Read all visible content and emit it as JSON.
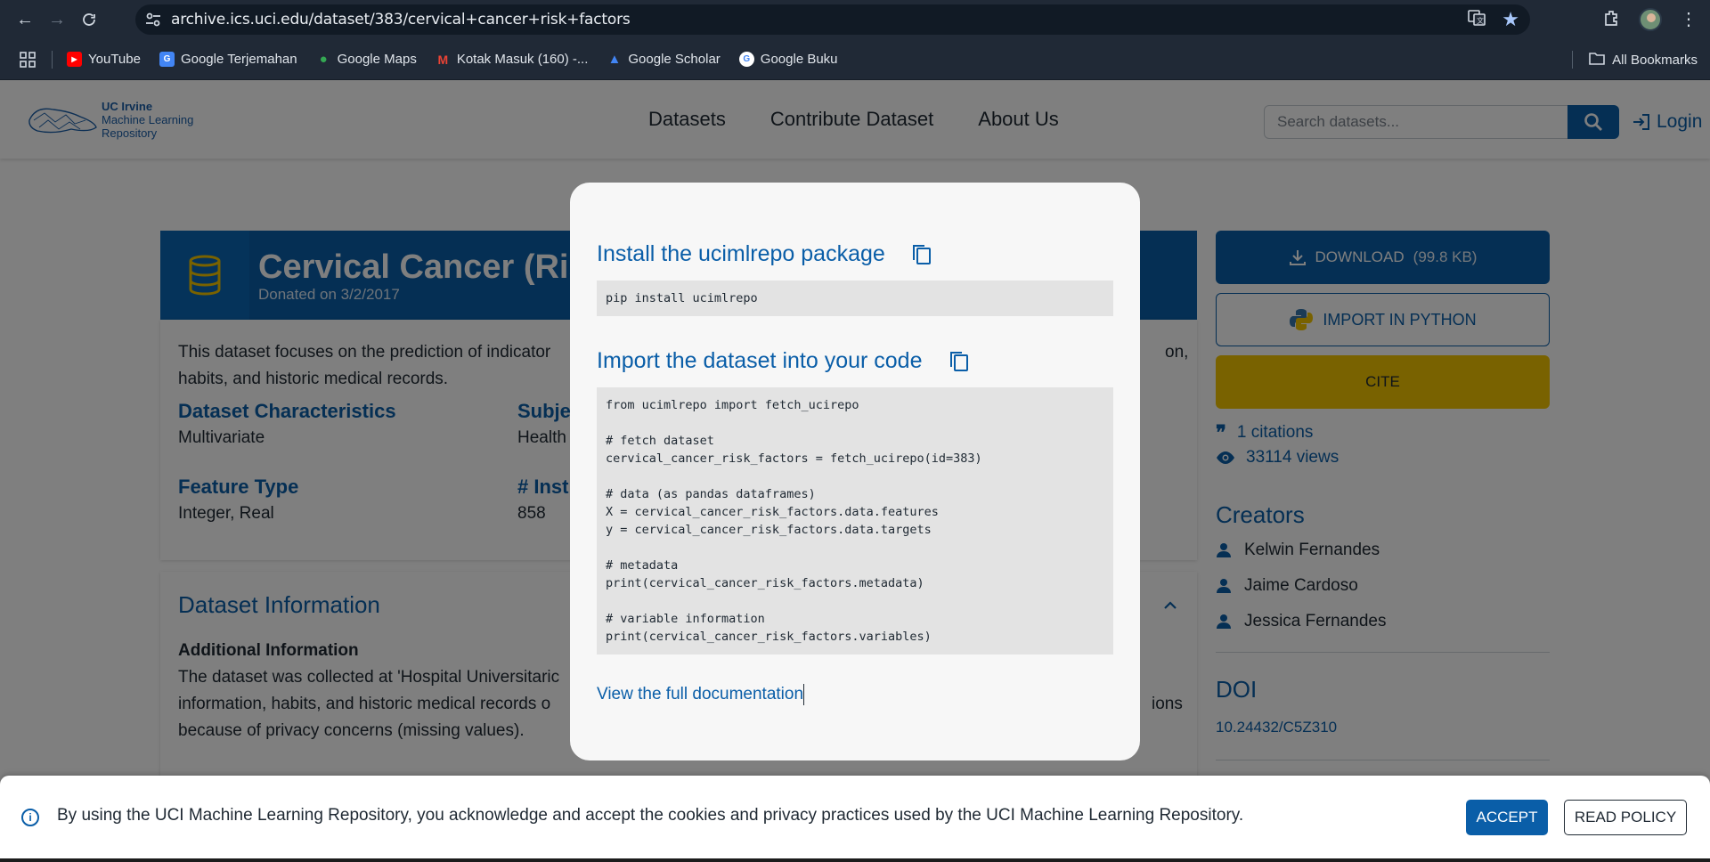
{
  "browser": {
    "url": "archive.ics.uci.edu/dataset/383/cervical+cancer+risk+factors",
    "bookmarks": [
      {
        "label": "YouTube",
        "icon": "youtube-icon",
        "color": "#ff0000"
      },
      {
        "label": "Google Terjemahan",
        "icon": "translate-icon",
        "color": "#4285f4"
      },
      {
        "label": "Google Maps",
        "icon": "maps-icon",
        "color": "#34a853"
      },
      {
        "label": "Kotak Masuk (160) -...",
        "icon": "gmail-icon",
        "color": "#ea4335"
      },
      {
        "label": "Google Scholar",
        "icon": "scholar-icon",
        "color": "#4285f4"
      },
      {
        "label": "Google Buku",
        "icon": "google-icon",
        "color": "#ffffff"
      }
    ],
    "all_bookmarks": "All Bookmarks"
  },
  "site": {
    "logo": {
      "line1": "UC Irvine",
      "line2": "Machine Learning",
      "line3": "Repository"
    },
    "nav": [
      "Datasets",
      "Contribute Dataset",
      "About Us"
    ],
    "search_placeholder": "Search datasets...",
    "login": "Login"
  },
  "dataset": {
    "title": "Cervical Cancer (Risk",
    "donated": "Donated on 3/2/2017",
    "desc_line1": "This dataset focuses on the prediction of indicator",
    "desc_line1_end": "on,",
    "desc_line2": "habits, and historic medical records.",
    "characteristics_label": "Dataset Characteristics",
    "characteristics_value": "Multivariate",
    "subject_label": "Subje",
    "subject_value": "Health",
    "feature_label": "Feature Type",
    "feature_value": "Integer, Real",
    "instances_label": "# Inst",
    "instances_value": "858",
    "info_title": "Dataset Information",
    "additional_title": "Additional Information",
    "add_line1": "The dataset was collected at 'Hospital Universitaric",
    "add_line2": "information, habits, and historic medical records o",
    "add_line2_end": "ions",
    "add_line3": "because of privacy concerns (missing values)."
  },
  "sidebar": {
    "download": "DOWNLOAD",
    "download_size": "(99.8 KB)",
    "import_python": "IMPORT IN PYTHON",
    "cite": "CITE",
    "citations": "1 citations",
    "views": "33114 views",
    "creators_title": "Creators",
    "creators": [
      "Kelwin Fernandes",
      "Jaime Cardoso",
      "Jessica Fernandes"
    ],
    "doi_title": "DOI",
    "doi": "10.24432/C5Z310"
  },
  "modal": {
    "install_title": "Install the ucimlrepo package",
    "install_code": "pip install ucimlrepo",
    "import_title": "Import the dataset into your code",
    "import_code": "from ucimlrepo import fetch_ucirepo\n\n# fetch dataset\ncervical_cancer_risk_factors = fetch_ucirepo(id=383)\n\n# data (as pandas dataframes)\nX = cervical_cancer_risk_factors.data.features\ny = cervical_cancer_risk_factors.data.targets\n\n# metadata\nprint(cervical_cancer_risk_factors.metadata)\n\n# variable information\nprint(cervical_cancer_risk_factors.variables)",
    "doc_link": "View the full documentation"
  },
  "cookie": {
    "text": "By using the UCI Machine Learning Repository, you acknowledge and accept the cookies and privacy practices used by the UCI Machine Learning Repository.",
    "accept": "ACCEPT",
    "read_policy": "READ POLICY"
  },
  "colors": {
    "brand_blue": "#0a5ea8",
    "cite_yellow": "#f2c500"
  }
}
